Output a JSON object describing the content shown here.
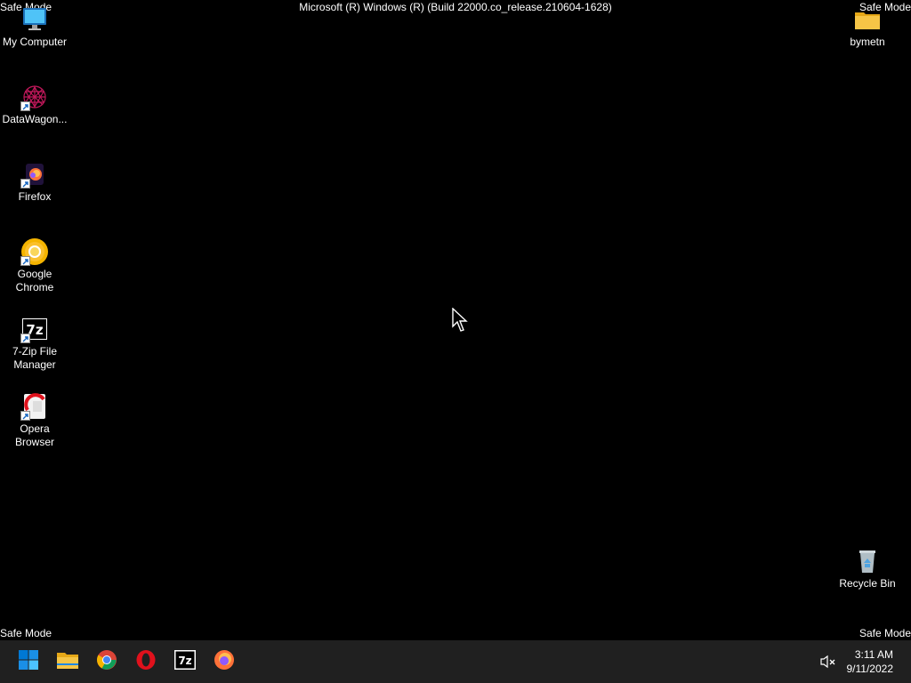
{
  "overlay": {
    "safe_mode_tl": "Safe Mode",
    "safe_mode_tr": "Safe Mode",
    "safe_mode_bl": "Safe Mode",
    "safe_mode_br": "Safe Mode",
    "build_text": "Microsoft (R) Windows (R) (Build 22000.co_release.210604-1628)"
  },
  "desktop": {
    "icons": [
      {
        "label": "My Computer",
        "icon": "monitor-icon"
      },
      {
        "label": "DataWagon...",
        "icon": "datawagon-icon"
      },
      {
        "label": "Firefox",
        "icon": "firefox-icon"
      },
      {
        "label": "Google Chrome",
        "icon": "chrome-icon"
      },
      {
        "label": "7-Zip File Manager",
        "icon": "7zip-icon"
      },
      {
        "label": "Opera Browser",
        "icon": "opera-icon"
      },
      {
        "label": "bymetn",
        "icon": "folder-icon"
      },
      {
        "label": "Recycle Bin",
        "icon": "recycle-bin-icon"
      }
    ]
  },
  "taskbar": {
    "items": [
      "start-icon",
      "file-explorer-icon",
      "chrome-icon",
      "opera-icon",
      "7zip-icon",
      "firefox-icon"
    ],
    "time": "3:11 AM",
    "date": "9/11/2022"
  },
  "colors": {
    "desktop_bg": "#000000",
    "taskbar_bg": "#202020",
    "start_blue": "#0078d4",
    "folder_yellow": "#f6c546"
  }
}
